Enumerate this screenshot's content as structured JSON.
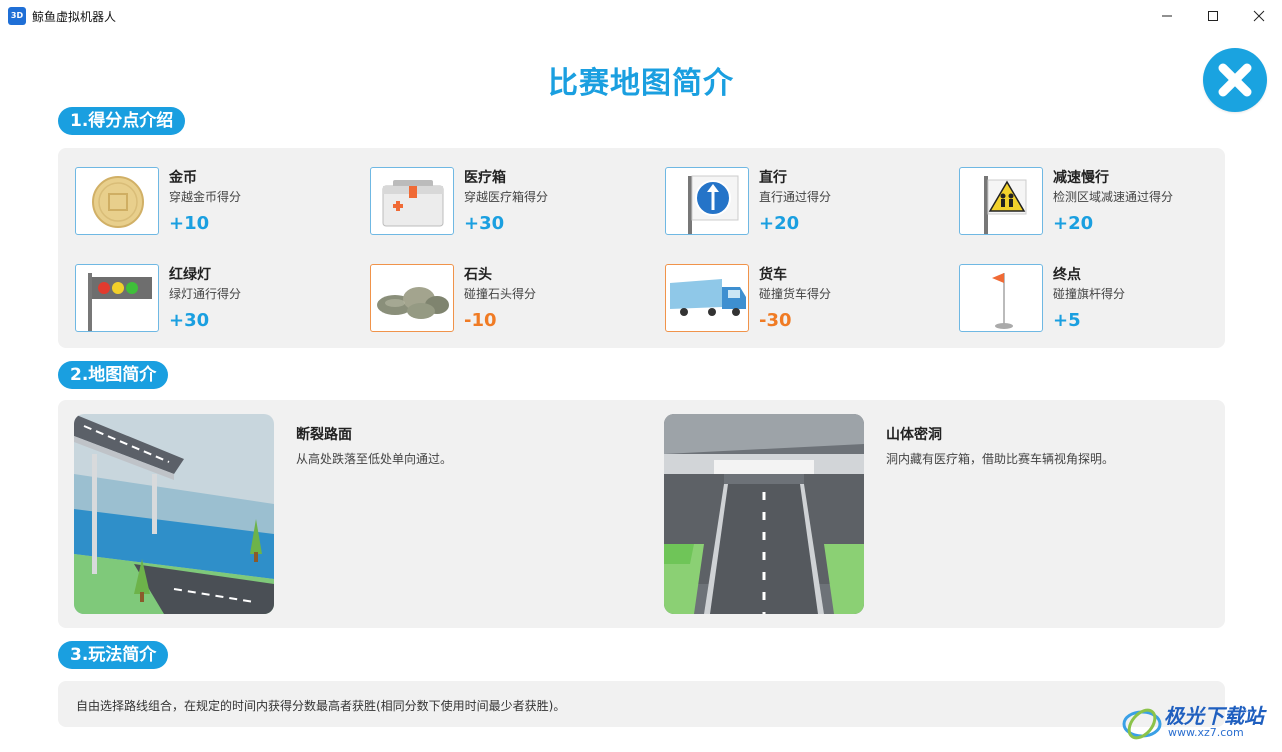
{
  "window": {
    "title": "鲸鱼虚拟机器人",
    "icon": "3d-app-icon"
  },
  "page_title": "比赛地图简介",
  "sections": {
    "scoring": {
      "label": "1.得分点介绍"
    },
    "maps": {
      "label": "2.地图简介"
    },
    "gameplay": {
      "label": "3.玩法简介",
      "text": "自由选择路线组合，在规定的时间内获得分数最高者获胜(相同分数下使用时间最少者获胜)。"
    }
  },
  "score_items": [
    {
      "name": "金币",
      "desc": "穿越金币得分",
      "score": "+10",
      "icon": "gold-coin"
    },
    {
      "name": "医疗箱",
      "desc": "穿越医疗箱得分",
      "score": "+30",
      "icon": "medical-kit"
    },
    {
      "name": "直行",
      "desc": "直行通过得分",
      "score": "+20",
      "icon": "straight-arrow-sign"
    },
    {
      "name": "减速慢行",
      "desc": "检测区域减速通过得分",
      "score": "+20",
      "icon": "slow-down-sign"
    },
    {
      "name": "红绿灯",
      "desc": "绿灯通行得分",
      "score": "+30",
      "icon": "traffic-light"
    },
    {
      "name": "石头",
      "desc": "碰撞石头得分",
      "score": "-10",
      "icon": "rocks"
    },
    {
      "name": "货车",
      "desc": "碰撞货车得分",
      "score": "-30",
      "icon": "truck"
    },
    {
      "name": "终点",
      "desc": "碰撞旗杆得分",
      "score": "+5",
      "icon": "finish-flag"
    }
  ],
  "maps": [
    {
      "name": "断裂路面",
      "desc": "从高处跌落至低处单向通过。"
    },
    {
      "name": "山体密洞",
      "desc": "洞内藏有医疗箱，借助比赛车辆视角探明。"
    }
  ],
  "watermark": {
    "name": "极光下载站",
    "url": "www.xz7.com"
  },
  "colors": {
    "accent": "#1a9fe0",
    "negative": "#f07b24",
    "panel": "#f1f1f1"
  }
}
